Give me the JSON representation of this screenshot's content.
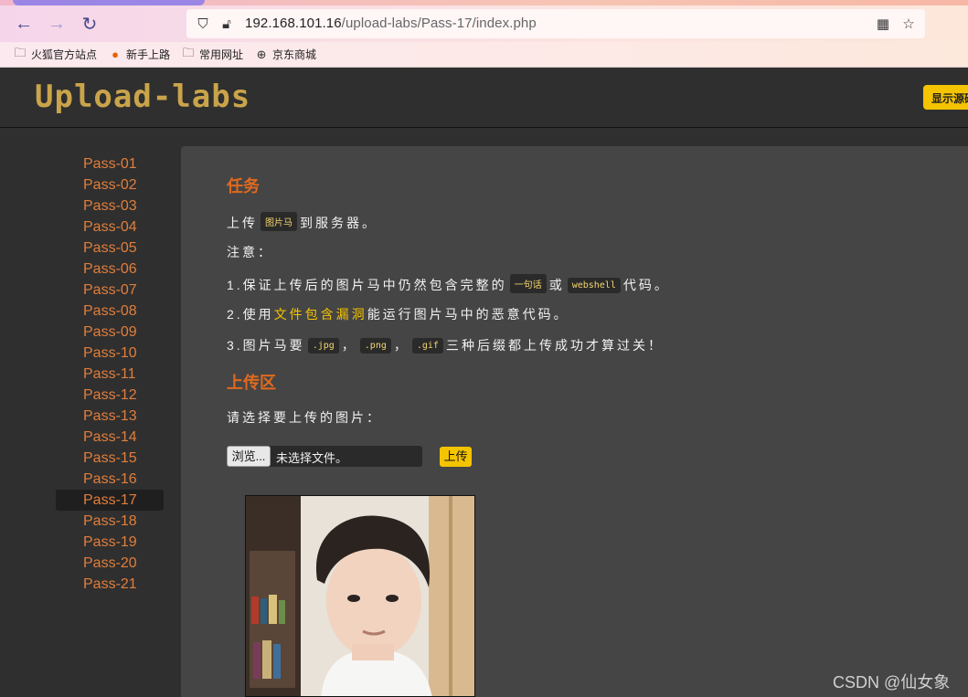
{
  "browser": {
    "url_host": "192.168.101.16",
    "url_path": "/upload-labs/Pass-17/index.php",
    "bookmarks": [
      {
        "label": "火狐官方站点",
        "icon": "folder-icon"
      },
      {
        "label": "新手上路",
        "icon": "firefox-icon"
      },
      {
        "label": "常用网址",
        "icon": "folder-icon"
      },
      {
        "label": "京东商城",
        "icon": "globe-icon"
      }
    ]
  },
  "header": {
    "logo_text": "Upload-labs",
    "source_button": "显示源码"
  },
  "sidebar": {
    "active": "Pass-17",
    "items": [
      "Pass-01",
      "Pass-02",
      "Pass-03",
      "Pass-04",
      "Pass-05",
      "Pass-06",
      "Pass-07",
      "Pass-08",
      "Pass-09",
      "Pass-10",
      "Pass-11",
      "Pass-12",
      "Pass-13",
      "Pass-14",
      "Pass-15",
      "Pass-16",
      "Pass-17",
      "Pass-18",
      "Pass-19",
      "Pass-20",
      "Pass-21"
    ]
  },
  "task": {
    "title": "任务",
    "line1_a": "上传",
    "line1_code": "图片马",
    "line1_b": "到服务器。",
    "note": "注意：",
    "item1_a": "1.保证上传后的图片马中仍然包含完整的",
    "item1_code1": "一句话",
    "item1_mid": "或",
    "item1_code2": "webshell",
    "item1_b": "代码。",
    "item2_a": "2.使用",
    "item2_hl": "文件包含漏洞",
    "item2_b": "能运行图片马中的恶意代码。",
    "item3_a": "3.图片马要",
    "item3_code1": ".jpg",
    "item3_sep1": "，",
    "item3_code2": ".png",
    "item3_sep2": "，",
    "item3_code3": ".gif",
    "item3_b": "三种后缀都上传成功才算过关！"
  },
  "upload": {
    "title": "上传区",
    "prompt": "请选择要上传的图片：",
    "browse": "浏览...",
    "no_file": "未选择文件。",
    "submit": "上传"
  },
  "watermark": "CSDN @仙女象"
}
